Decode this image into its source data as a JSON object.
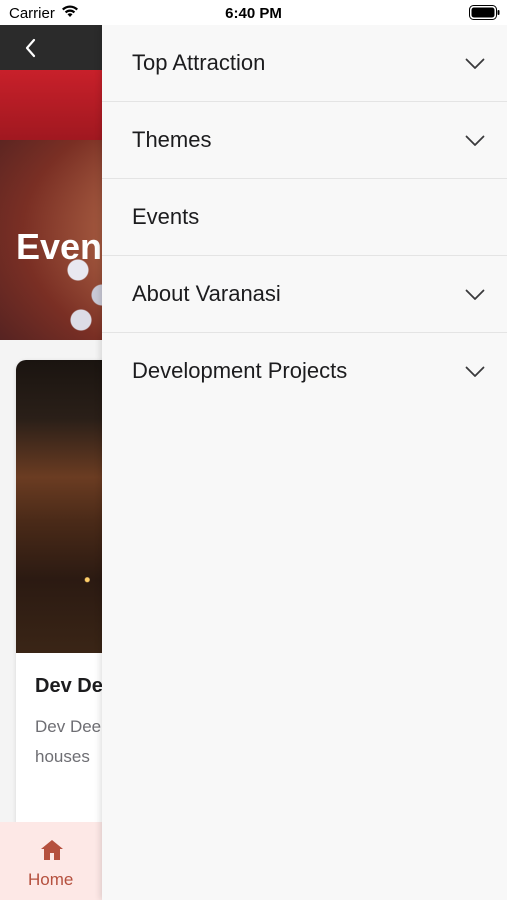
{
  "status_bar": {
    "carrier": "Carrier",
    "time": "6:40 PM"
  },
  "background_page": {
    "hero_title": "Events",
    "card": {
      "title": "Dev Deepawali",
      "description": "Dev Deepawali is the festival of Gods.People light up the houses"
    },
    "tabbar": {
      "home_label": "Home"
    }
  },
  "drawer": {
    "items": [
      {
        "label": "Top Attraction",
        "expandable": true
      },
      {
        "label": "Themes",
        "expandable": true
      },
      {
        "label": "Events",
        "expandable": false
      },
      {
        "label": "About Varanasi",
        "expandable": true
      },
      {
        "label": "Development Projects",
        "expandable": true
      }
    ]
  },
  "colors": {
    "drawer_bg": "#f8f8f8",
    "divider": "#e4e4e4",
    "tabbar_bg": "#fde8e6",
    "accent": "#b5503e"
  }
}
